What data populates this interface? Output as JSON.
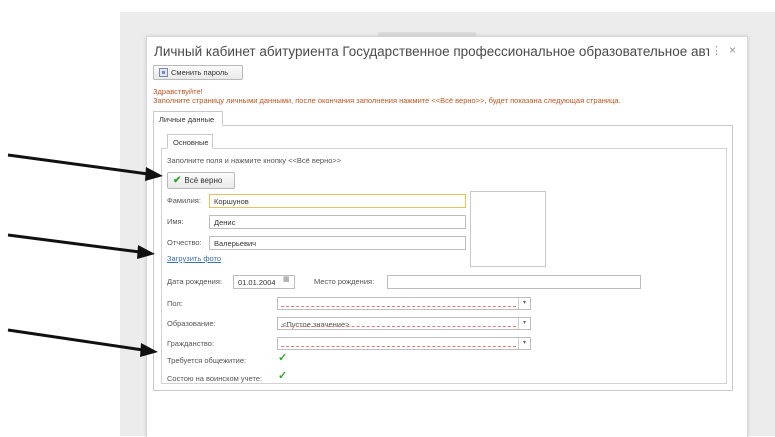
{
  "window": {
    "title": "Личный кабинет абитуриента Государственное профессиональное образовательное автономное уч...",
    "more_glyph": "⋮",
    "close_glyph": "×"
  },
  "toolbar": {
    "change_password_label": "Сменить пароль"
  },
  "messages": {
    "greeting": "Здравствуйте!",
    "instruction": "Заполните страницу личными данными, после окончания заполнения нажмите <<Всё верно>>, будет показана следующая страница."
  },
  "tabs": {
    "outer": "Личные данные",
    "inner": "Основные"
  },
  "form": {
    "hint": "Заполните поля и нажмите кнопку <<Всё верно>>",
    "ok_button": "Всё верно",
    "surname_label": "Фамилия:",
    "surname_value": "Коршунов",
    "name_label": "Имя:",
    "name_value": "Денис",
    "patronymic_label": "Отчество:",
    "patronymic_value": "Валерьевич",
    "upload_photo": "Загрузить фото",
    "birthdate_label": "Дата рождения:",
    "birthdate_value": "01.01.2004",
    "birthplace_label": "Место рождения:",
    "birthplace_value": "",
    "gender_label": "Пол:",
    "gender_value": "",
    "education_label": "Образование:",
    "education_value": "<Пустое значение>",
    "citizenship_label": "Гражданство:",
    "citizenship_value": "",
    "dormitory_label": "Требуется общежитие:",
    "dormitory_checked": true,
    "military_label": "Состою на воинском учете:",
    "military_checked": true
  },
  "icons": {
    "checkmark": "✔",
    "combo_arrow": "▾",
    "calendar": "▦",
    "check": "✓"
  },
  "colors": {
    "warning_text": "#c0551f",
    "link": "#3d6fb8",
    "check_green": "#3aa335",
    "focus_border": "#e6c25a"
  }
}
